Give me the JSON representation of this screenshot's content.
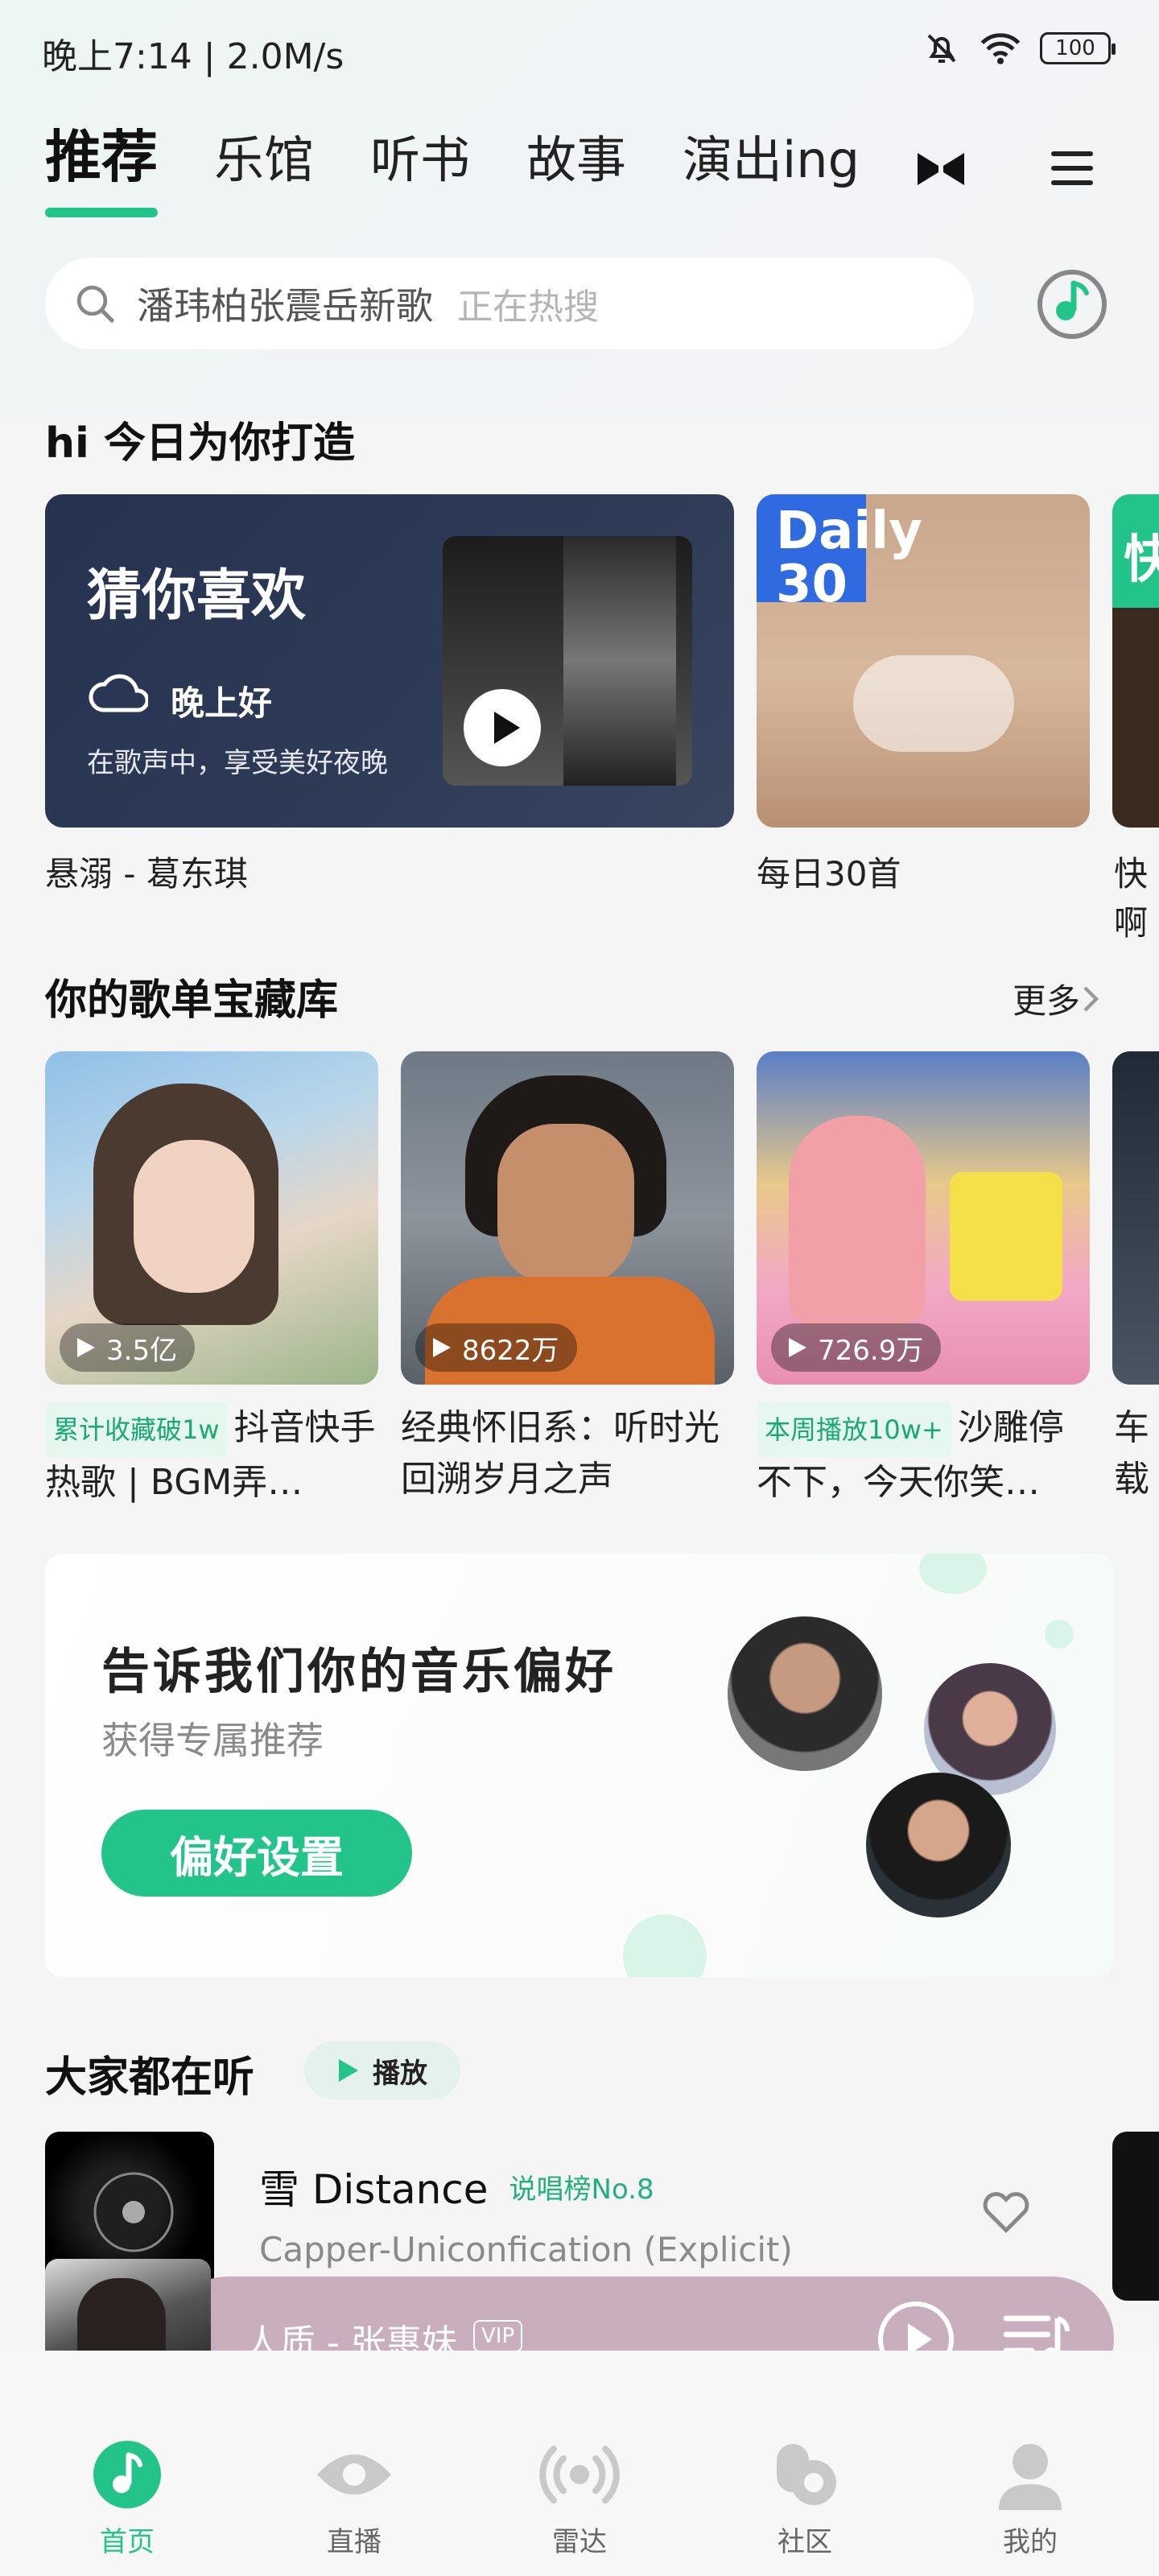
{
  "status_bar": {
    "time": "晚上7:14 | 2.0M/s",
    "battery": "100",
    "icons": [
      "bell-off-icon",
      "wifi-icon",
      "battery-icon"
    ]
  },
  "tabs": [
    {
      "label": "推荐",
      "active": true
    },
    {
      "label": "乐馆",
      "active": false
    },
    {
      "label": "听书",
      "active": false
    },
    {
      "label": "故事",
      "active": false
    },
    {
      "label": "演出ing",
      "active": false
    }
  ],
  "search": {
    "placeholder": "潘玮柏张震岳新歌",
    "hint": "正在热搜"
  },
  "daily": {
    "title": "hi 今日为你打造",
    "guess": {
      "heading": "猜你喜欢",
      "greeting": "晚上好",
      "subtitle": "在歌声中，享受美好夜晚",
      "caption": "悬溺 - 葛东琪"
    },
    "daily30": {
      "logo_line1": "Daily",
      "logo_line2": "30",
      "caption": "每日30首"
    },
    "third_caption": "快啊",
    "third_logo": "快"
  },
  "playlists": {
    "title": "你的歌单宝藏库",
    "more": "更多",
    "items": [
      {
        "count": "3.5亿",
        "tag": "累计收藏破1w",
        "title": "抖音快手热歌 | BGM弄…"
      },
      {
        "count": "8622万",
        "tag": "",
        "title": "经典怀旧系：听时光回溯岁月之声"
      },
      {
        "count": "726.9万",
        "tag": "本周播放10w+",
        "title": "沙雕停不下，今天你笑…"
      },
      {
        "count": "",
        "tag": "",
        "title": "车载一路"
      }
    ]
  },
  "preference": {
    "title": "告诉我们你的音乐偏好",
    "subtitle": "获得专属推荐",
    "button": "偏好设置"
  },
  "everyone": {
    "title": "大家都在听",
    "play_label": "播放",
    "song": {
      "name": "雪 Distance",
      "badge": "说唱榜No.8",
      "artist": "Capper-Uniconfication (Explicit)"
    }
  },
  "mini_player": {
    "song": "人质 - 张惠妹",
    "badge": "VIP"
  },
  "bottom_nav": [
    {
      "label": "首页",
      "active": true
    },
    {
      "label": "直播",
      "active": false
    },
    {
      "label": "雷达",
      "active": false
    },
    {
      "label": "社区",
      "active": false
    },
    {
      "label": "我的",
      "active": false
    }
  ],
  "colors": {
    "accent": "#22c48a",
    "player_bg": "#c9aebd"
  }
}
